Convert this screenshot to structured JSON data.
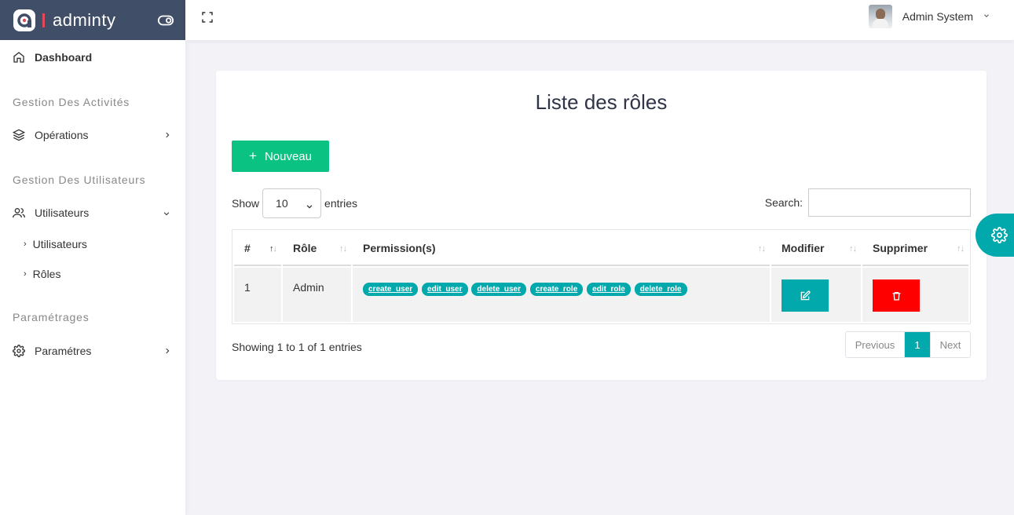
{
  "brand": {
    "name": "adminty"
  },
  "header": {
    "user_name": "Admin System"
  },
  "sidebar": {
    "dashboard": "Dashboard",
    "section_activities": "Gestion Des Activités",
    "operations": "Opérations",
    "section_users": "Gestion Des Utilisateurs",
    "users": "Utilisateurs",
    "sub_items": [
      "Utilisateurs",
      "Rôles"
    ],
    "section_settings": "Paramétrages",
    "settings": "Paramétres"
  },
  "main": {
    "title": "Liste des rôles",
    "new_button": "Nouveau",
    "show_label": "Show",
    "entries_label": "entries",
    "entries_value": "10",
    "search_label": "Search:",
    "search_value": "",
    "columns": [
      "#",
      "Rôle",
      "Permission(s)",
      "Modifier",
      "Supprimer"
    ],
    "rows": [
      {
        "id": "1",
        "role": "Admin",
        "permissions": [
          "create_user",
          "edit_user",
          "delete_user",
          "create_role",
          "edit_role",
          "delete_role"
        ]
      }
    ],
    "info": "Showing 1 to 1 of 1 entries",
    "pagination": {
      "previous": "Previous",
      "current": "1",
      "next": "Next"
    }
  },
  "colors": {
    "brand_bg": "#404e67",
    "accent": "#01a9ac",
    "success": "#0ac282",
    "danger": "#ff0000"
  }
}
